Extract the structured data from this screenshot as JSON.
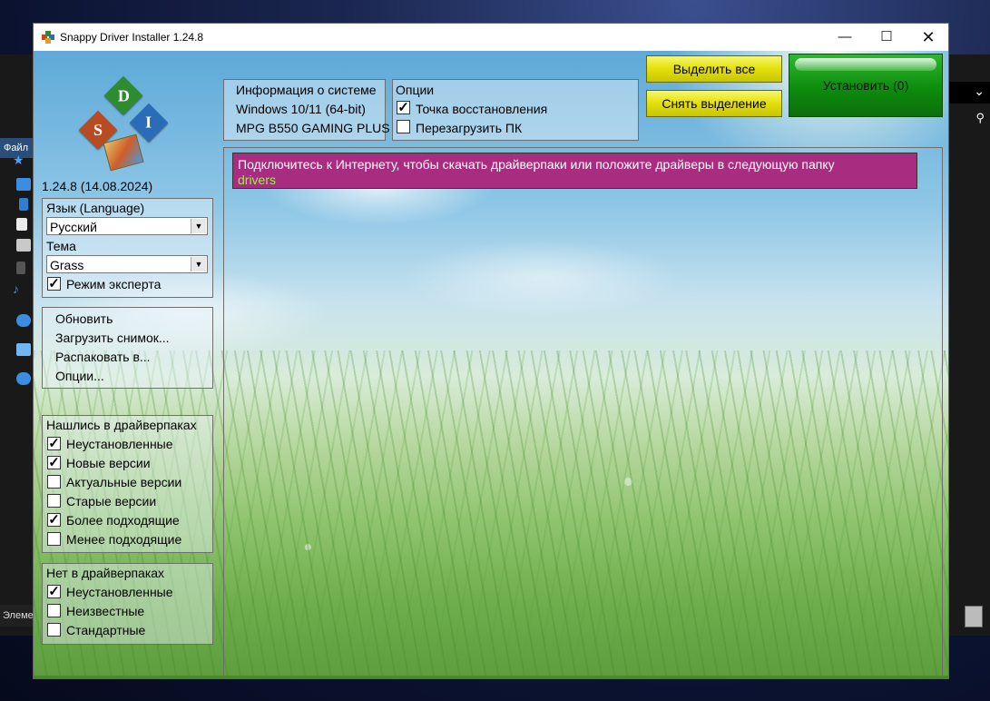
{
  "background": {
    "left_tab": "Файл",
    "left_status": "Элеме"
  },
  "window": {
    "title": "Snappy Driver Installer 1.24.8"
  },
  "sidebar": {
    "logo_letters": [
      "D",
      "S",
      "I"
    ],
    "version": "1.24.8 (14.08.2024)",
    "language_label": "Язык (Language)",
    "language_value": "Русский",
    "theme_label": "Тема",
    "theme_value": "Grass",
    "expert_mode": {
      "label": "Режим эксперта",
      "checked": true
    },
    "actions": [
      "Обновить",
      "Загрузить снимок...",
      "Распаковать в...",
      "Опции..."
    ],
    "found_group": {
      "title": "Нашлись в драйверпаках",
      "items": [
        {
          "label": "Неустановленные",
          "checked": true
        },
        {
          "label": "Новые версии",
          "checked": true
        },
        {
          "label": "Актуальные версии",
          "checked": false
        },
        {
          "label": "Старые версии",
          "checked": false
        },
        {
          "label": "Более подходящие",
          "checked": true
        },
        {
          "label": "Менее подходящие",
          "checked": false
        }
      ]
    },
    "missing_group": {
      "title": "Нет в драйверпаках",
      "items": [
        {
          "label": "Неустановленные",
          "checked": true
        },
        {
          "label": "Неизвестные",
          "checked": false
        },
        {
          "label": "Стандартные",
          "checked": false
        }
      ]
    }
  },
  "system_info": {
    "title": "Информация о системе",
    "os": "Windows 10/11 (64-bit)",
    "board": "MPG B550 GAMING PLUS"
  },
  "options": {
    "title": "Опции",
    "restore_point": {
      "label": "Точка восстановления",
      "checked": true
    },
    "reboot": {
      "label": "Перезагрузить ПК",
      "checked": false
    }
  },
  "buttons": {
    "select_all": "Выделить все",
    "deselect": "Снять выделение",
    "install": "Установить (0)"
  },
  "notice": {
    "message": "Подключитесь к Интернету, чтобы скачать драйверпаки или положите драйверы в следующую папку",
    "folder": "drivers"
  },
  "colors": {
    "notice_bg": "#a82d80",
    "folder_text": "#9cf04c",
    "install_green": "#0d8c0d",
    "button_yellow": "#e6e20e"
  }
}
